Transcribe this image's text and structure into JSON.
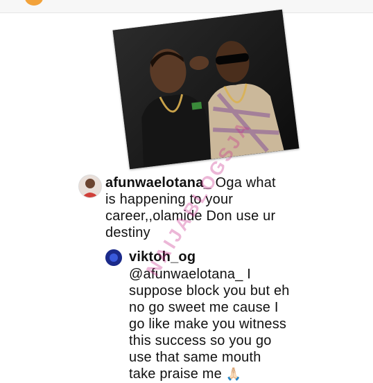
{
  "comment1": {
    "username": "afunwaelotana_",
    "lines": [
      "Oga what",
      "is happening to your",
      "career,,olamide Don use ur",
      "destiny"
    ]
  },
  "comment2": {
    "username": "viktoh_og",
    "lines": [
      "@afunwaelotana_ I",
      "suppose block you but eh",
      "no go sweet me cause I",
      "go like make you witness",
      "this success so you go",
      "use that same mouth",
      "take praise me"
    ],
    "emoji": "🙏🏻"
  },
  "watermark": "NAIJABLOGSJA",
  "icons": {
    "top": "notification-dot-icon",
    "reaction": "praying-hands-icon"
  },
  "colors": {
    "accent": "#f2a23a",
    "watermark": "#c8328c"
  }
}
